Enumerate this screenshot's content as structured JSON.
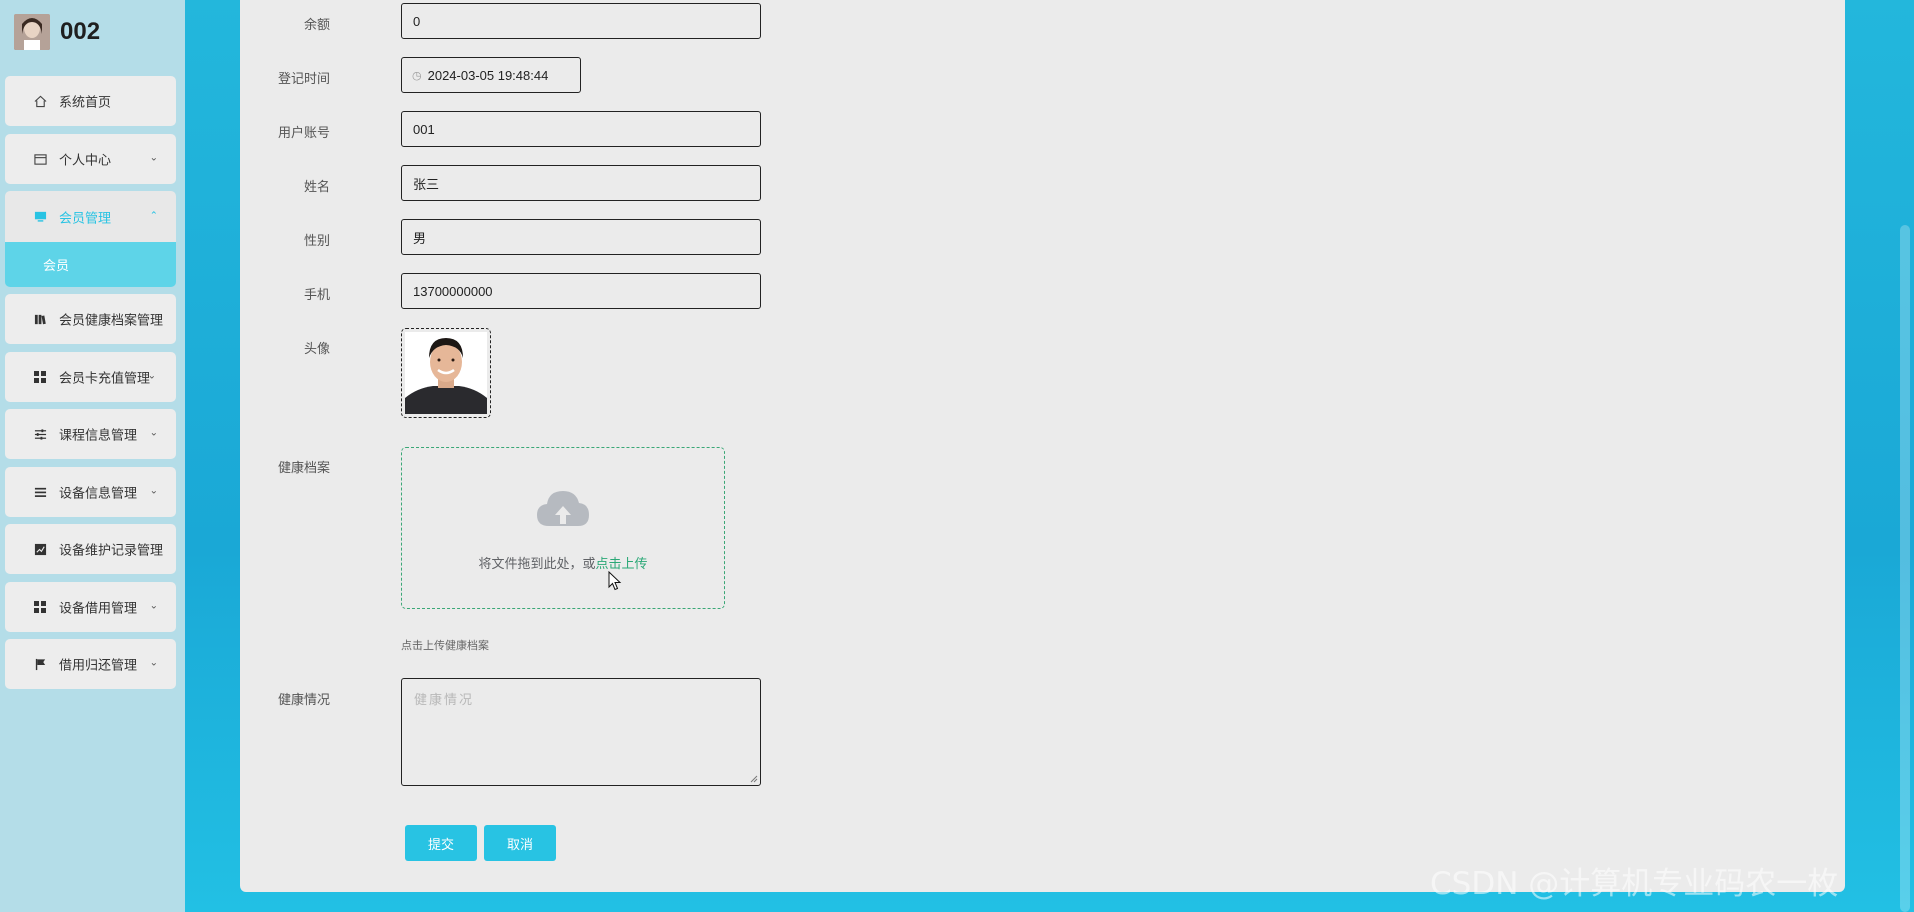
{
  "brand": {
    "title": "002"
  },
  "sidebar": {
    "items": [
      {
        "label": "系统首页",
        "icon": "home-icon"
      },
      {
        "label": "个人中心",
        "icon": "card-icon"
      },
      {
        "label": "会员管理",
        "icon": "monitor-icon",
        "active": true
      },
      {
        "label": "会员健康档案管理",
        "icon": "books-icon"
      },
      {
        "label": "会员卡充值管理",
        "icon": "grid-icon"
      },
      {
        "label": "课程信息管理",
        "icon": "sliders-icon"
      },
      {
        "label": "设备信息管理",
        "icon": "list-icon"
      },
      {
        "label": "设备维护记录管理",
        "icon": "chart-icon"
      },
      {
        "label": "设备借用管理",
        "icon": "grid-icon"
      },
      {
        "label": "借用归还管理",
        "icon": "flag-icon"
      }
    ],
    "submenu": {
      "label": "会员"
    }
  },
  "form": {
    "balance": {
      "label": "余额",
      "value": "0"
    },
    "register_time": {
      "label": "登记时间",
      "value": "2024-03-05 19:48:44"
    },
    "account": {
      "label": "用户账号",
      "value": "001"
    },
    "name": {
      "label": "姓名",
      "value": "张三"
    },
    "gender": {
      "label": "性别",
      "value": "男"
    },
    "phone": {
      "label": "手机",
      "value": "13700000000"
    },
    "avatar": {
      "label": "头像"
    },
    "health_file": {
      "label": "健康档案",
      "drag_text": "将文件拖到此处，或",
      "link_text": "点击上传",
      "tip": "点击上传健康档案"
    },
    "health_status": {
      "label": "健康情况",
      "placeholder": "健康情况"
    }
  },
  "buttons": {
    "submit": "提交",
    "cancel": "取消"
  },
  "watermark": "CSDN @计算机专业码农一枚",
  "colors": {
    "accent": "#28c3e3",
    "upload_border": "#3aa776",
    "background": "#1aa8d6"
  }
}
